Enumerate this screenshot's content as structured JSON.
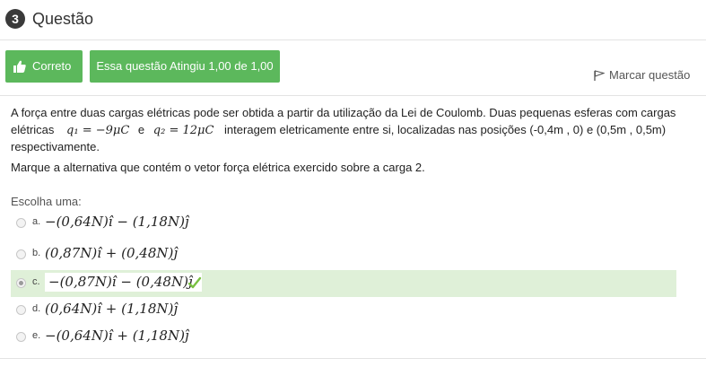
{
  "question": {
    "number": "3",
    "title": "Questão"
  },
  "status": {
    "correct_label": "Correto",
    "score_label": "Essa questão Atingiu 1,00 de 1,00"
  },
  "flag": {
    "label": "Marcar questão"
  },
  "body": {
    "line1": "A força entre duas cargas elétricas pode ser obtida a partir da utilização da Lei de Coulomb. Duas pequenas esferas com cargas",
    "line2_prefix": "elétricas",
    "q1": "q₁ = −9μC",
    "conj": "e",
    "q2": "q₂ = 12μC",
    "line2_suffix": "interagem eletricamente entre si, localizadas nas posições (-0,4m , 0) e (0,5m , 0,5m)",
    "line3": "respectivamente.",
    "instruction": "Marque a alternativa que contém o vetor força elétrica exercido sobre a carga 2."
  },
  "choose_label": "Escolha uma:",
  "options": [
    {
      "letter": "a.",
      "expr": "−(0,64N)î − (1,18N)ĵ",
      "selected": false
    },
    {
      "letter": "b.",
      "expr": "(0,87N)î + (0,48N)ĵ",
      "selected": false
    },
    {
      "letter": "c.",
      "expr": "−(0,87N)î − (0,48N)ĵ",
      "selected": true
    },
    {
      "letter": "d.",
      "expr": "(0,64N)î + (1,18N)ĵ",
      "selected": false
    },
    {
      "letter": "e.",
      "expr": "−(0,64N)î + (1,18N)ĵ",
      "selected": false
    }
  ],
  "colors": {
    "success": "#5cb85c",
    "selected_bg": "#dff0d8",
    "check": "#7ac142"
  },
  "icons": {
    "correct": "thumbs-up-icon",
    "flag": "flag-icon",
    "result": "checkmark-icon"
  }
}
